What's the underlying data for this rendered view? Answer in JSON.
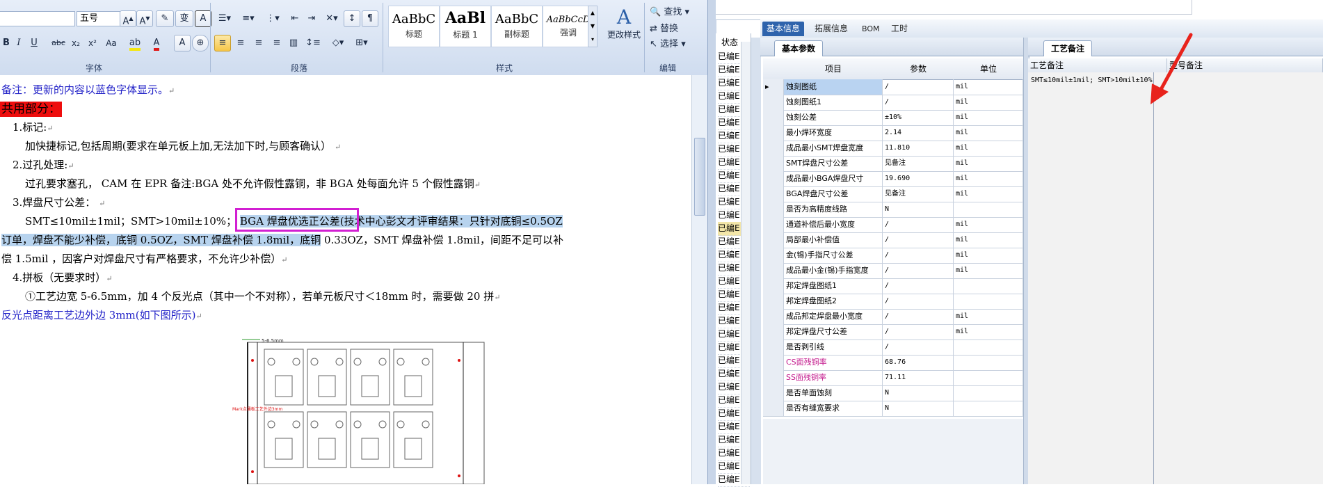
{
  "word": {
    "ribbon": {
      "font_size": "五号",
      "group_font": "字体",
      "group_paragraph": "段落",
      "group_styles": "样式",
      "group_editing": "编辑",
      "styles": [
        {
          "sample": "AaBbC",
          "name": "标题"
        },
        {
          "sample": "AaBl",
          "name": "标题 1"
        },
        {
          "sample": "AaBbC",
          "name": "副标题"
        },
        {
          "sample": "AaBbCcD",
          "name": "强调"
        }
      ],
      "change_styles": "更改样式",
      "find": "查找",
      "replace": "替换",
      "select": "选择",
      "font_buttons": [
        "A",
        "A",
        "B",
        "I",
        "U",
        "abc",
        "x₂",
        "x²",
        "Aa",
        "A"
      ]
    },
    "doc": {
      "note": "备注：更新的内容以蓝色字体显示。",
      "common_title": "共用部分：",
      "item1_title": "1.标记:",
      "item1_body": "加快捷标记,包括周期(要求在单元板上加,无法加下时,与顾客确认）",
      "item2_title": "2.过孔处理:",
      "item2_body": "过孔要求塞孔， CAM 在 EPR 备注:BGA 处不允许假性露铜，非 BGA 处每面允许 5 个假性露铜",
      "item3_title": "3.焊盘尺寸公差：",
      "item3_line1_a": "SMT≤10mil±1mil；SMT>10mil±10%；",
      "item3_line1_boxed": "BGA 焊盘优选正公差",
      "item3_line1_b": "(技术中心彭文才评审结果：只针对底铜≤0.5OZ",
      "item3_line2_hl": "订单，焊盘不能少补偿，底铜 0.5OZ，SMT 焊盘补偿 1.8mil，底铜",
      "item3_line2_rest": " 0.33OZ，SMT 焊盘补偿 1.8mil，间距不足可以补",
      "item3_line3": "偿 1.5mil ，因客户对焊盘尺寸有严格要求，不允许少补偿）",
      "item4_title": "4.拼板（无要求时）",
      "item4_body": "①工艺边宽 5-6.5mm，加 4 个反光点（其中一个不对称），若单元板尺寸＜18mm 时，需要做 20 拼",
      "item4_note": "反光点距离工艺边外边 3mm(如下图所示)",
      "figure_dim": "5-6.5mm",
      "figure_caption": "Mark点通板工艺外边3mm"
    }
  },
  "erp": {
    "tabs": [
      "基本信息",
      "拓展信息",
      "BOM",
      "工时"
    ],
    "status_header": "状态",
    "status_values": [
      "已编E",
      "已编E",
      "已编E",
      "已编E",
      "已编E",
      "已编E",
      "已编E",
      "已编E",
      "已编E",
      "已编E",
      "已编E",
      "已编E",
      "已编E",
      "已编E",
      "已编E",
      "已编E",
      "已编E",
      "已编E",
      "已编E",
      "已编E",
      "已编E",
      "已编E",
      "已编E",
      "已编E",
      "已编E",
      "已编E",
      "已编E",
      "已编E",
      "已编E",
      "已编E",
      "已编E",
      "已编E",
      "已编E"
    ],
    "basic_params_title": "基本参数",
    "grid_headers": [
      "项目",
      "参数",
      "单位"
    ],
    "rows": [
      {
        "item": "蚀刻图纸",
        "param": "/",
        "unit": "mil"
      },
      {
        "item": "蚀刻图纸1",
        "param": "/",
        "unit": "mil"
      },
      {
        "item": "蚀刻公差",
        "param": "±10%",
        "unit": "mil"
      },
      {
        "item": "最小焊环宽度",
        "param": "2.14",
        "unit": "mil"
      },
      {
        "item": "成品最小SMT焊盘宽度",
        "param": "11.810",
        "unit": "mil"
      },
      {
        "item": "SMT焊盘尺寸公差",
        "param": "见备注",
        "unit": "mil"
      },
      {
        "item": "成品最小BGA焊盘尺寸",
        "param": "19.690",
        "unit": "mil"
      },
      {
        "item": "BGA焊盘尺寸公差",
        "param": "见备注",
        "unit": "mil"
      },
      {
        "item": "是否为高精度线路",
        "param": "N",
        "unit": ""
      },
      {
        "item": "通道补偿后最小宽度",
        "param": "/",
        "unit": "mil"
      },
      {
        "item": "局部最小补偿值",
        "param": "/",
        "unit": "mil"
      },
      {
        "item": "金(锡)手指尺寸公差",
        "param": "/",
        "unit": "mil"
      },
      {
        "item": "成品最小金(锡)手指宽度",
        "param": "/",
        "unit": "mil"
      },
      {
        "item": "邦定焊盘图纸1",
        "param": "/",
        "unit": ""
      },
      {
        "item": "邦定焊盘图纸2",
        "param": "/",
        "unit": ""
      },
      {
        "item": "成品邦定焊盘最小宽度",
        "param": "/",
        "unit": "mil"
      },
      {
        "item": "邦定焊盘尺寸公差",
        "param": "/",
        "unit": "mil"
      },
      {
        "item": "是否剥引线",
        "param": "/",
        "unit": ""
      },
      {
        "item": "CS面残铜率",
        "param": "68.76",
        "unit": ""
      },
      {
        "item": "SS面残铜率",
        "param": "71.11",
        "unit": ""
      },
      {
        "item": "是否单面蚀刻",
        "param": "N",
        "unit": ""
      },
      {
        "item": "是否有缝宽要求",
        "param": "N",
        "unit": ""
      }
    ],
    "process_title": "工艺备注",
    "process_col1": "工艺备注",
    "process_col2": "型号备注",
    "process_text": "SMT≤10mil±1mil; SMT>10mil±10%",
    "annotation_color": "#e8231c"
  }
}
